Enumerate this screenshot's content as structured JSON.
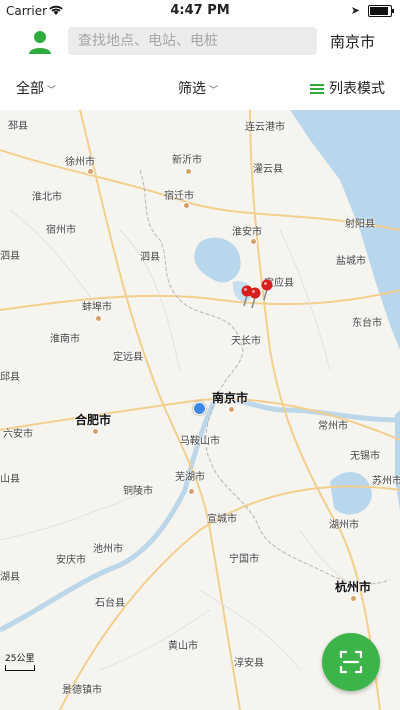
{
  "status": {
    "carrier": "Carrier",
    "time": "4:47 PM"
  },
  "header": {
    "search_placeholder": "查找地点、电站、电桩",
    "city": "南京市",
    "avatar_icon": "user-icon"
  },
  "filters": {
    "all": "全部",
    "screen": "筛选",
    "list_mode": "列表模式"
  },
  "map": {
    "cities": [
      {
        "name": "邳县"
      },
      {
        "name": "连云港市"
      },
      {
        "name": "徐州市"
      },
      {
        "name": "新沂市"
      },
      {
        "name": "灌云县"
      },
      {
        "name": "淮北市"
      },
      {
        "name": "宿迁市"
      },
      {
        "name": "淮安市"
      },
      {
        "name": "射阳县"
      },
      {
        "name": "宿州市"
      },
      {
        "name": "泗县"
      },
      {
        "name": "宝应县"
      },
      {
        "name": "盐城市"
      },
      {
        "name": "蚌埠市"
      },
      {
        "name": "东台市"
      },
      {
        "name": "淮南市"
      },
      {
        "name": "天长市"
      },
      {
        "name": "定远县"
      },
      {
        "name": "南京市",
        "major": true
      },
      {
        "name": "合肥市",
        "major": true
      },
      {
        "name": "马鞍山市"
      },
      {
        "name": "常州市"
      },
      {
        "name": "六安市"
      },
      {
        "name": "无锡市"
      },
      {
        "name": "芜湖市"
      },
      {
        "name": "苏州市"
      },
      {
        "name": "铜陵市"
      },
      {
        "name": "宣城市"
      },
      {
        "name": "湖州市"
      },
      {
        "name": "池州市"
      },
      {
        "name": "安庆市"
      },
      {
        "name": "宁国市"
      },
      {
        "name": "杭州市",
        "major": true
      },
      {
        "name": "石台县"
      },
      {
        "name": "黄山市"
      },
      {
        "name": "淳安县"
      },
      {
        "name": "景德镇市"
      },
      {
        "name": "山县"
      },
      {
        "name": "泗县"
      },
      {
        "name": "邱县"
      },
      {
        "name": "湖县"
      }
    ],
    "scale_label": "25公里",
    "pin_count": 3
  },
  "scan_button_icon": "scan-icon"
}
